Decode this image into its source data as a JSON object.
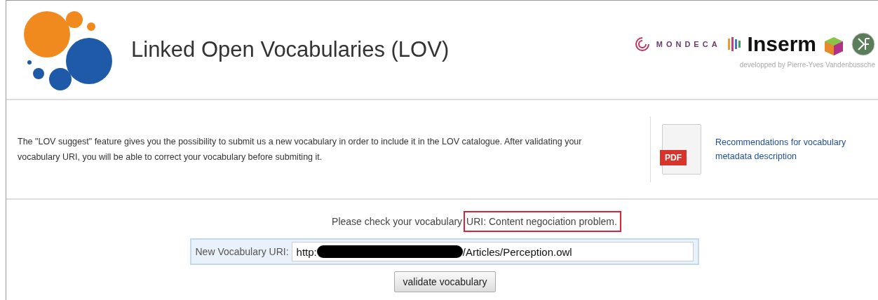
{
  "header": {
    "title": "Linked Open Vocabularies (LOV)",
    "partners": {
      "mondeca": "MONDECA",
      "inserm": "Inserm",
      "credit": "developped by Pierre-Yves Vandenbussche"
    }
  },
  "intro": {
    "text": "The \"LOV suggest\" feature gives you the possibility to submit us a new vocabulary in order to include it in the LOV catalogue. After validating your vocabulary URI, you will be able to correct your vocabulary before submiting it.",
    "pdf_label": "PDF",
    "link": "Recommendations for vocabulary metadata description"
  },
  "message": {
    "lead": "Please check your vocabulary",
    "highlighted": "URI: Content negociation problem."
  },
  "form": {
    "label": "New Vocabulary URI:",
    "value_start": "http:",
    "value_end": "/Articles/Perception.owl",
    "button": "validate vocabulary"
  }
}
